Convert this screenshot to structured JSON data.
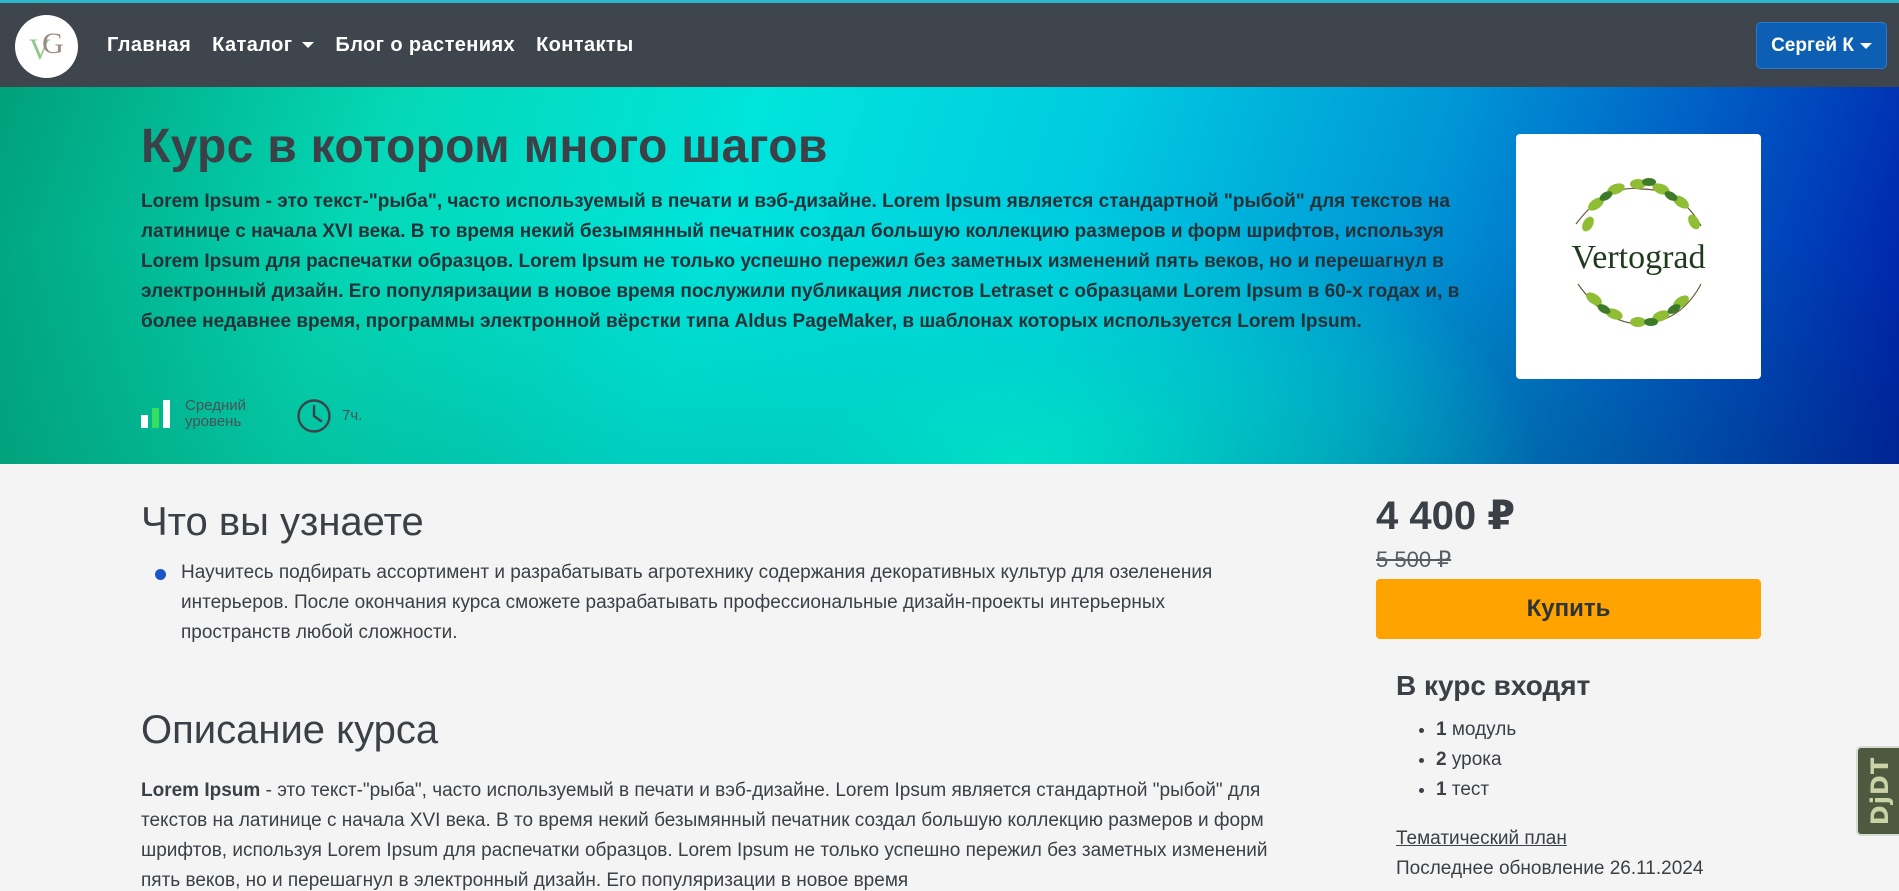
{
  "navbar": {
    "logo_icon": "vg-logo-icon",
    "links": [
      {
        "label": "Главная"
      },
      {
        "label": "Каталог",
        "dropdown": true
      },
      {
        "label": "Блог о растениях"
      },
      {
        "label": "Контакты"
      }
    ],
    "user_label": "Сергей К"
  },
  "hero": {
    "title": "Курс в котором много шагов",
    "desc_bold": "Lorem Ipsum",
    "desc_text": " - это текст-\"рыба\", часто используемый в печати и вэб-дизайне. Lorem Ipsum является стандартной \"рыбой\" для текстов на латинице с начала XVI века. В то время некий безымянный печатник создал большую коллекцию размеров и форм шрифтов, используя Lorem Ipsum для распечатки образцов. Lorem Ipsum не только успешно пережил без заметных изменений пять веков, но и перешагнул в электронный дизайн. Его популяризации в новое время послужили публикация листов Letraset с образцами Lorem Ipsum в 60-х годах и, в более недавнее время, программы электронной вёрстки типа Aldus PageMaker, в шаблонах которых используется Lorem Ipsum.",
    "level_line1": "Средний",
    "level_line2": "уровень",
    "level_value": "2 of 3",
    "duration": "7ч.",
    "image_text": "Vertograd"
  },
  "learn": {
    "title": "Что вы узнаете",
    "items": [
      "Научитесь подбирать ассортимент и разрабатывать агротехнику содержания декоративных культур для озеленения интерьеров. После окончания курса сможете разрабатывать профессиональные дизайн-проекты интерьерных пространств любой сложности."
    ]
  },
  "description": {
    "title": "Описание курса",
    "bold": "Lorem Ipsum",
    "text": " - это текст-\"рыба\", часто используемый в печати и вэб-дизайне. Lorem Ipsum является стандартной \"рыбой\" для текстов на латинице с начала XVI века. В то время некий безымянный печатник создал большую коллекцию размеров и форм шрифтов, используя Lorem Ipsum для распечатки образцов. Lorem Ipsum не только успешно пережил без заметных изменений пять веков, но и перешагнул в электронный дизайн. Его популяризации в новое время"
  },
  "sidebar": {
    "price": "4 400 ₽",
    "old_price": "5 500 ₽",
    "buy_label": "Купить",
    "includes_title": "В курс входят",
    "includes": [
      {
        "count": "1",
        "label": " модуль"
      },
      {
        "count": "2",
        "label": " урока"
      },
      {
        "count": "1",
        "label": " тест"
      }
    ],
    "plan_link": "Тематический план",
    "updated": "Последнее обновление 26.11.2024"
  },
  "debug_toolbar": {
    "label": "DjDT"
  },
  "colors": {
    "navbar": "#3e454d",
    "accent_blue": "#0d5fb4",
    "buy_button": "#ffa300",
    "level_active": "#37e05a"
  }
}
